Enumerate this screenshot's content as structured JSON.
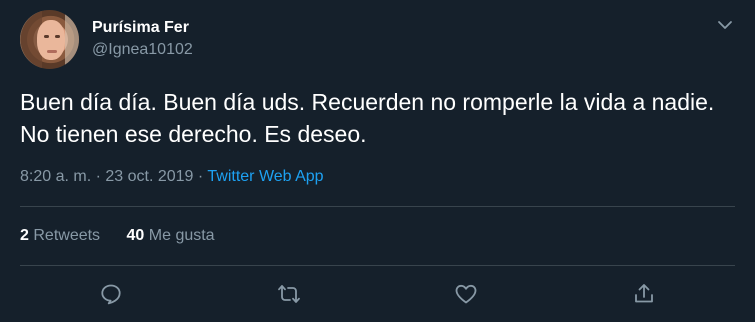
{
  "user": {
    "display_name": "Purísima Fer",
    "handle": "@Ignea10102"
  },
  "tweet": {
    "text": "Buen día día. Buen día uds. Recuerden no romperle la vida a nadie. No tienen ese derecho. Es deseo.",
    "timestamp": "8:20 a. m. · 23 oct. 2019 · ",
    "source": "Twitter Web App"
  },
  "stats": {
    "retweets_count": "2",
    "retweets_label": "Retweets",
    "likes_count": "40",
    "likes_label": "Me gusta"
  },
  "colors": {
    "background": "#15202b",
    "secondary_text": "#8899a6",
    "accent": "#1da1f2",
    "divider": "#38444d"
  },
  "icons": [
    "chevron-down-icon",
    "reply-icon",
    "retweet-icon",
    "like-icon",
    "share-icon"
  ]
}
